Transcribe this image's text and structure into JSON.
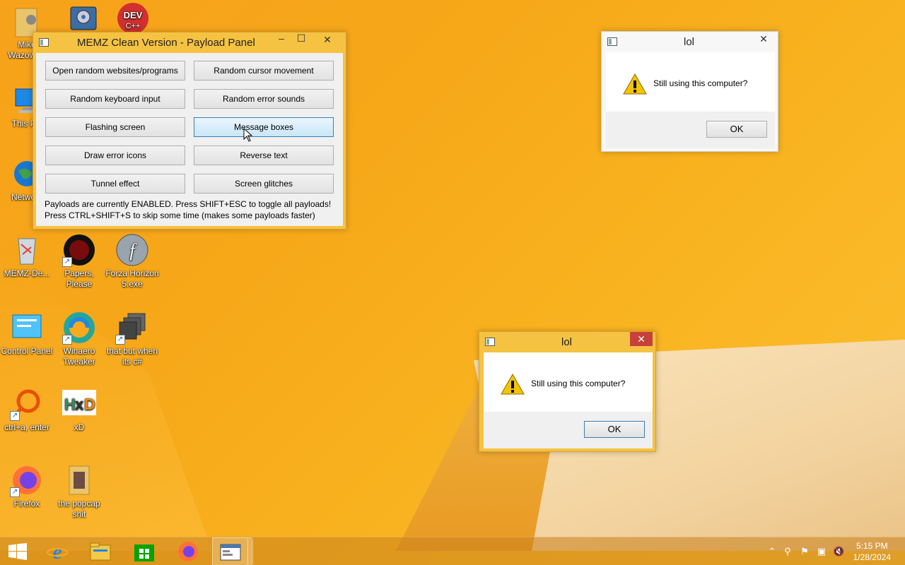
{
  "desktop": {
    "icons": [
      {
        "label": "Mike Wazowski",
        "name": "desktop-icon-user-folder"
      },
      {
        "label": "This PC",
        "name": "desktop-icon-this-pc"
      },
      {
        "label": "Network",
        "name": "desktop-icon-network"
      },
      {
        "label": "MEMZ-De...",
        "name": "desktop-icon-memz"
      },
      {
        "label": "Papers, Please",
        "name": "desktop-icon-papers-please"
      },
      {
        "label": "Forza Horizon 5.exe",
        "name": "desktop-icon-forza"
      },
      {
        "label": "Control Panel",
        "name": "desktop-icon-control-panel"
      },
      {
        "label": "Winaero Tweaker",
        "name": "desktop-icon-winaero"
      },
      {
        "label": "that but when its c#",
        "name": "desktop-icon-that-but"
      },
      {
        "label": "ctrl+a, enter",
        "name": "desktop-icon-ctrl-a"
      },
      {
        "label": "xD",
        "name": "desktop-icon-xd"
      },
      {
        "label": "Firefox",
        "name": "desktop-icon-firefox"
      },
      {
        "label": "the popcap shit",
        "name": "desktop-icon-popcap"
      }
    ]
  },
  "panel": {
    "title": "MEMZ Clean Version - Payload Panel",
    "buttons": [
      "Open random websites/programs",
      "Random cursor movement",
      "Random keyboard input",
      "Random error sounds",
      "Flashing screen",
      "Message boxes",
      "Draw error icons",
      "Reverse text",
      "Tunnel effect",
      "Screen glitches"
    ],
    "status_line1": "Payloads are currently ENABLED. Press SHIFT+ESC to toggle all payloads!",
    "status_line2": "Press CTRL+SHIFT+S to skip some time (makes some payloads faster)"
  },
  "msgbox1": {
    "title": "lol",
    "message": "Still using this computer?",
    "ok": "OK"
  },
  "msgbox2": {
    "title": "lol",
    "message": "Still using this computer?",
    "ok": "OK"
  },
  "taskbar": {
    "time": "5:15 PM",
    "date": "1/28/2024",
    "items": [
      "start-button",
      "internet-explorer",
      "file-explorer",
      "store",
      "firefox",
      "memz-panel"
    ]
  },
  "colors": {
    "accent": "#f5c242",
    "close_red": "#c7403a",
    "hover_blue": "#c9e6f7"
  }
}
